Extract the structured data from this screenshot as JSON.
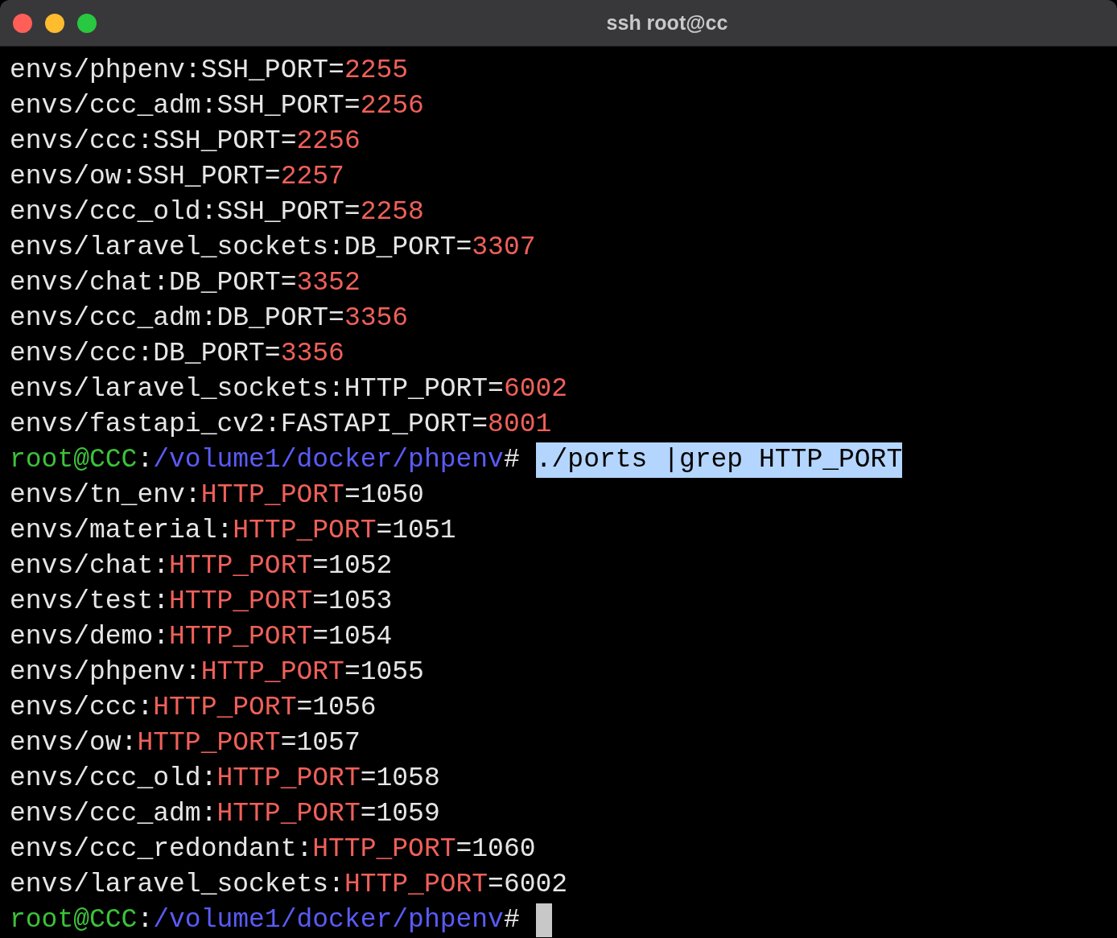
{
  "window": {
    "title": "ssh root@cc"
  },
  "lines": [
    {
      "kind": "output",
      "segments": [
        {
          "text": "envs/phpenv:SSH_PORT=",
          "kind": "plain"
        },
        {
          "text": "2255",
          "kind": "match"
        }
      ]
    },
    {
      "kind": "output",
      "segments": [
        {
          "text": "envs/ccc_adm:SSH_PORT=",
          "kind": "plain"
        },
        {
          "text": "2256",
          "kind": "match"
        }
      ]
    },
    {
      "kind": "output",
      "segments": [
        {
          "text": "envs/ccc:SSH_PORT=",
          "kind": "plain"
        },
        {
          "text": "2256",
          "kind": "match"
        }
      ]
    },
    {
      "kind": "output",
      "segments": [
        {
          "text": "envs/ow:SSH_PORT=",
          "kind": "plain"
        },
        {
          "text": "2257",
          "kind": "match"
        }
      ]
    },
    {
      "kind": "output",
      "segments": [
        {
          "text": "envs/ccc_old:SSH_PORT=",
          "kind": "plain"
        },
        {
          "text": "2258",
          "kind": "match"
        }
      ]
    },
    {
      "kind": "output",
      "segments": [
        {
          "text": "envs/laravel_sockets:DB_PORT=",
          "kind": "plain"
        },
        {
          "text": "3307",
          "kind": "match"
        }
      ]
    },
    {
      "kind": "output",
      "segments": [
        {
          "text": "envs/chat:DB_PORT=",
          "kind": "plain"
        },
        {
          "text": "3352",
          "kind": "match"
        }
      ]
    },
    {
      "kind": "output",
      "segments": [
        {
          "text": "envs/ccc_adm:DB_PORT=",
          "kind": "plain"
        },
        {
          "text": "3356",
          "kind": "match"
        }
      ]
    },
    {
      "kind": "output",
      "segments": [
        {
          "text": "envs/ccc:DB_PORT=",
          "kind": "plain"
        },
        {
          "text": "3356",
          "kind": "match"
        }
      ]
    },
    {
      "kind": "output",
      "segments": [
        {
          "text": "envs/laravel_sockets:HTTP_PORT=",
          "kind": "plain"
        },
        {
          "text": "6002",
          "kind": "match"
        }
      ]
    },
    {
      "kind": "output",
      "segments": [
        {
          "text": "envs/fastapi_cv2:FASTAPI_PORT=",
          "kind": "plain"
        },
        {
          "text": "8001",
          "kind": "match"
        }
      ]
    },
    {
      "kind": "prompt",
      "user": "root@CCC",
      "separator": ":",
      "path": "/volume1/docker/phpenv",
      "symbol": "#",
      "command": "./ports |grep HTTP_PORT",
      "selected": true
    },
    {
      "kind": "output",
      "segments": [
        {
          "text": "envs/tn_env:",
          "kind": "plain"
        },
        {
          "text": "HTTP_PORT",
          "kind": "match"
        },
        {
          "text": "=1050",
          "kind": "plain"
        }
      ]
    },
    {
      "kind": "output",
      "segments": [
        {
          "text": "envs/material:",
          "kind": "plain"
        },
        {
          "text": "HTTP_PORT",
          "kind": "match"
        },
        {
          "text": "=1051",
          "kind": "plain"
        }
      ]
    },
    {
      "kind": "output",
      "segments": [
        {
          "text": "envs/chat:",
          "kind": "plain"
        },
        {
          "text": "HTTP_PORT",
          "kind": "match"
        },
        {
          "text": "=1052",
          "kind": "plain"
        }
      ]
    },
    {
      "kind": "output",
      "segments": [
        {
          "text": "envs/test:",
          "kind": "plain"
        },
        {
          "text": "HTTP_PORT",
          "kind": "match"
        },
        {
          "text": "=1053",
          "kind": "plain"
        }
      ]
    },
    {
      "kind": "output",
      "segments": [
        {
          "text": "envs/demo:",
          "kind": "plain"
        },
        {
          "text": "HTTP_PORT",
          "kind": "match"
        },
        {
          "text": "=1054",
          "kind": "plain"
        }
      ]
    },
    {
      "kind": "output",
      "segments": [
        {
          "text": "envs/phpenv:",
          "kind": "plain"
        },
        {
          "text": "HTTP_PORT",
          "kind": "match"
        },
        {
          "text": "=1055",
          "kind": "plain"
        }
      ]
    },
    {
      "kind": "output",
      "segments": [
        {
          "text": "envs/ccc:",
          "kind": "plain"
        },
        {
          "text": "HTTP_PORT",
          "kind": "match"
        },
        {
          "text": "=1056",
          "kind": "plain"
        }
      ]
    },
    {
      "kind": "output",
      "segments": [
        {
          "text": "envs/ow:",
          "kind": "plain"
        },
        {
          "text": "HTTP_PORT",
          "kind": "match"
        },
        {
          "text": "=1057",
          "kind": "plain"
        }
      ]
    },
    {
      "kind": "output",
      "segments": [
        {
          "text": "envs/ccc_old:",
          "kind": "plain"
        },
        {
          "text": "HTTP_PORT",
          "kind": "match"
        },
        {
          "text": "=1058",
          "kind": "plain"
        }
      ]
    },
    {
      "kind": "output",
      "segments": [
        {
          "text": "envs/ccc_adm:",
          "kind": "plain"
        },
        {
          "text": "HTTP_PORT",
          "kind": "match"
        },
        {
          "text": "=1059",
          "kind": "plain"
        }
      ]
    },
    {
      "kind": "output",
      "segments": [
        {
          "text": "envs/ccc_redondant:",
          "kind": "plain"
        },
        {
          "text": "HTTP_PORT",
          "kind": "match"
        },
        {
          "text": "=1060",
          "kind": "plain"
        }
      ]
    },
    {
      "kind": "output",
      "segments": [
        {
          "text": "envs/laravel_sockets:",
          "kind": "plain"
        },
        {
          "text": "HTTP_PORT",
          "kind": "match"
        },
        {
          "text": "=6002",
          "kind": "plain"
        }
      ]
    },
    {
      "kind": "prompt",
      "user": "root@CCC",
      "separator": ":",
      "path": "/volume1/docker/phpenv",
      "symbol": "#",
      "cursor": true
    }
  ]
}
